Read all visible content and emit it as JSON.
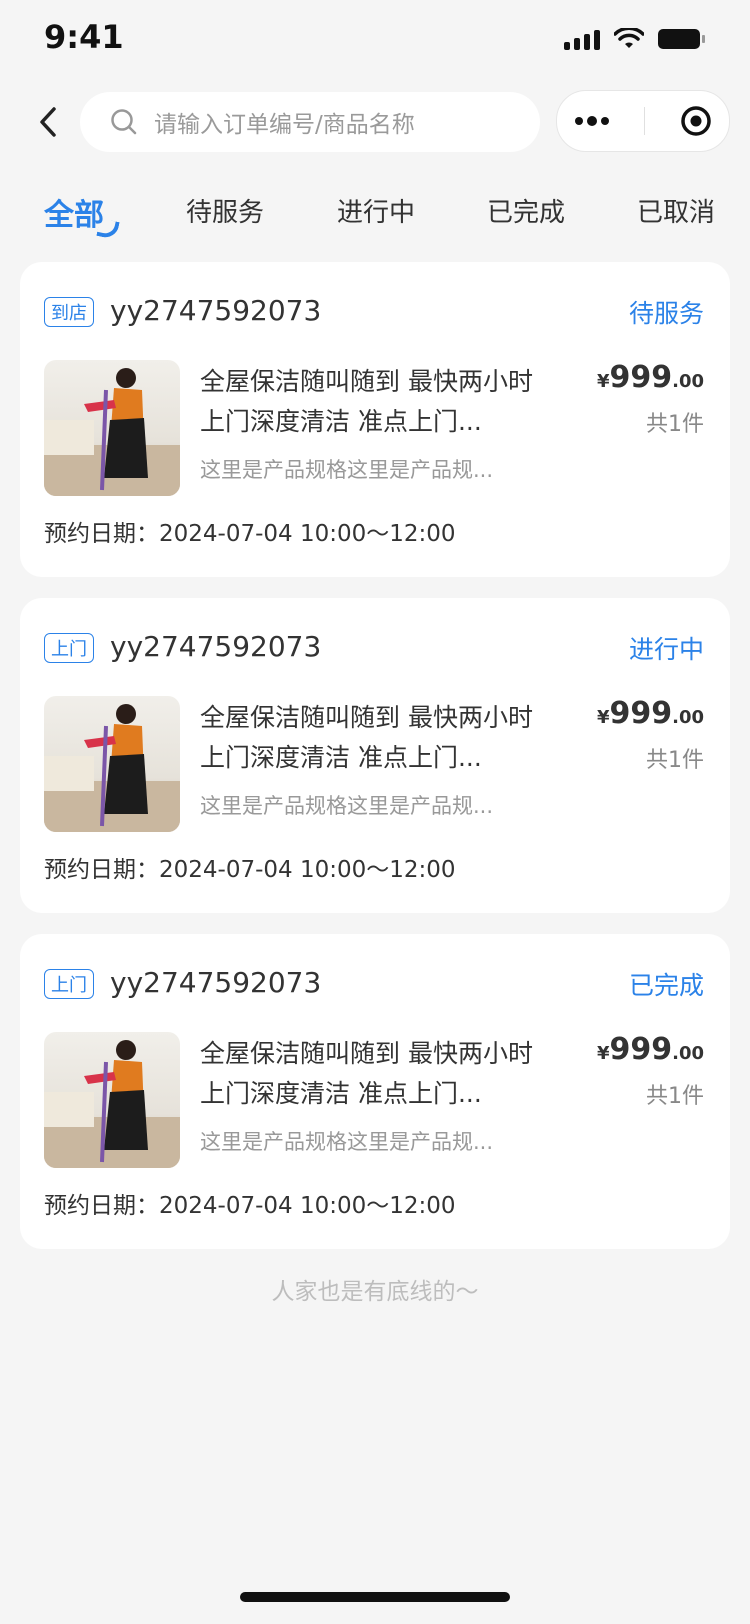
{
  "status_bar": {
    "time": "9:41"
  },
  "search": {
    "placeholder": "请输入订单编号/商品名称"
  },
  "tabs": [
    {
      "label": "全部",
      "active": true
    },
    {
      "label": "待服务"
    },
    {
      "label": "进行中"
    },
    {
      "label": "已完成"
    },
    {
      "label": "已取消"
    }
  ],
  "orders": [
    {
      "badge": "到店",
      "order_no": "yy2747592073",
      "status": "待服务",
      "title": "全屋保洁随叫随到 最快两小时上门深度清洁 准点上门...",
      "spec": "这里是产品规格这里是产品规...",
      "price_symbol": "¥",
      "price_int": "999",
      "price_dec": ".00",
      "qty": "共1件",
      "date": "预约日期：2024-07-04 10:00～12:00"
    },
    {
      "badge": "上门",
      "order_no": "yy2747592073",
      "status": "进行中",
      "title": "全屋保洁随叫随到 最快两小时上门深度清洁 准点上门...",
      "spec": "这里是产品规格这里是产品规...",
      "price_symbol": "¥",
      "price_int": "999",
      "price_dec": ".00",
      "qty": "共1件",
      "date": "预约日期：2024-07-04 10:00～12:00"
    },
    {
      "badge": "上门",
      "order_no": "yy2747592073",
      "status": "已完成",
      "title": "全屋保洁随叫随到 最快两小时上门深度清洁 准点上门...",
      "spec": "这里是产品规格这里是产品规...",
      "price_symbol": "¥",
      "price_int": "999",
      "price_dec": ".00",
      "qty": "共1件",
      "date": "预约日期：2024-07-04 10:00～12:00"
    }
  ],
  "footer_tip": "人家也是有底线的～",
  "colors": {
    "accent": "#2b82e8",
    "background": "#f5f5f5"
  },
  "icons": [
    "back-icon",
    "search-icon",
    "more-icon",
    "target-icon"
  ]
}
